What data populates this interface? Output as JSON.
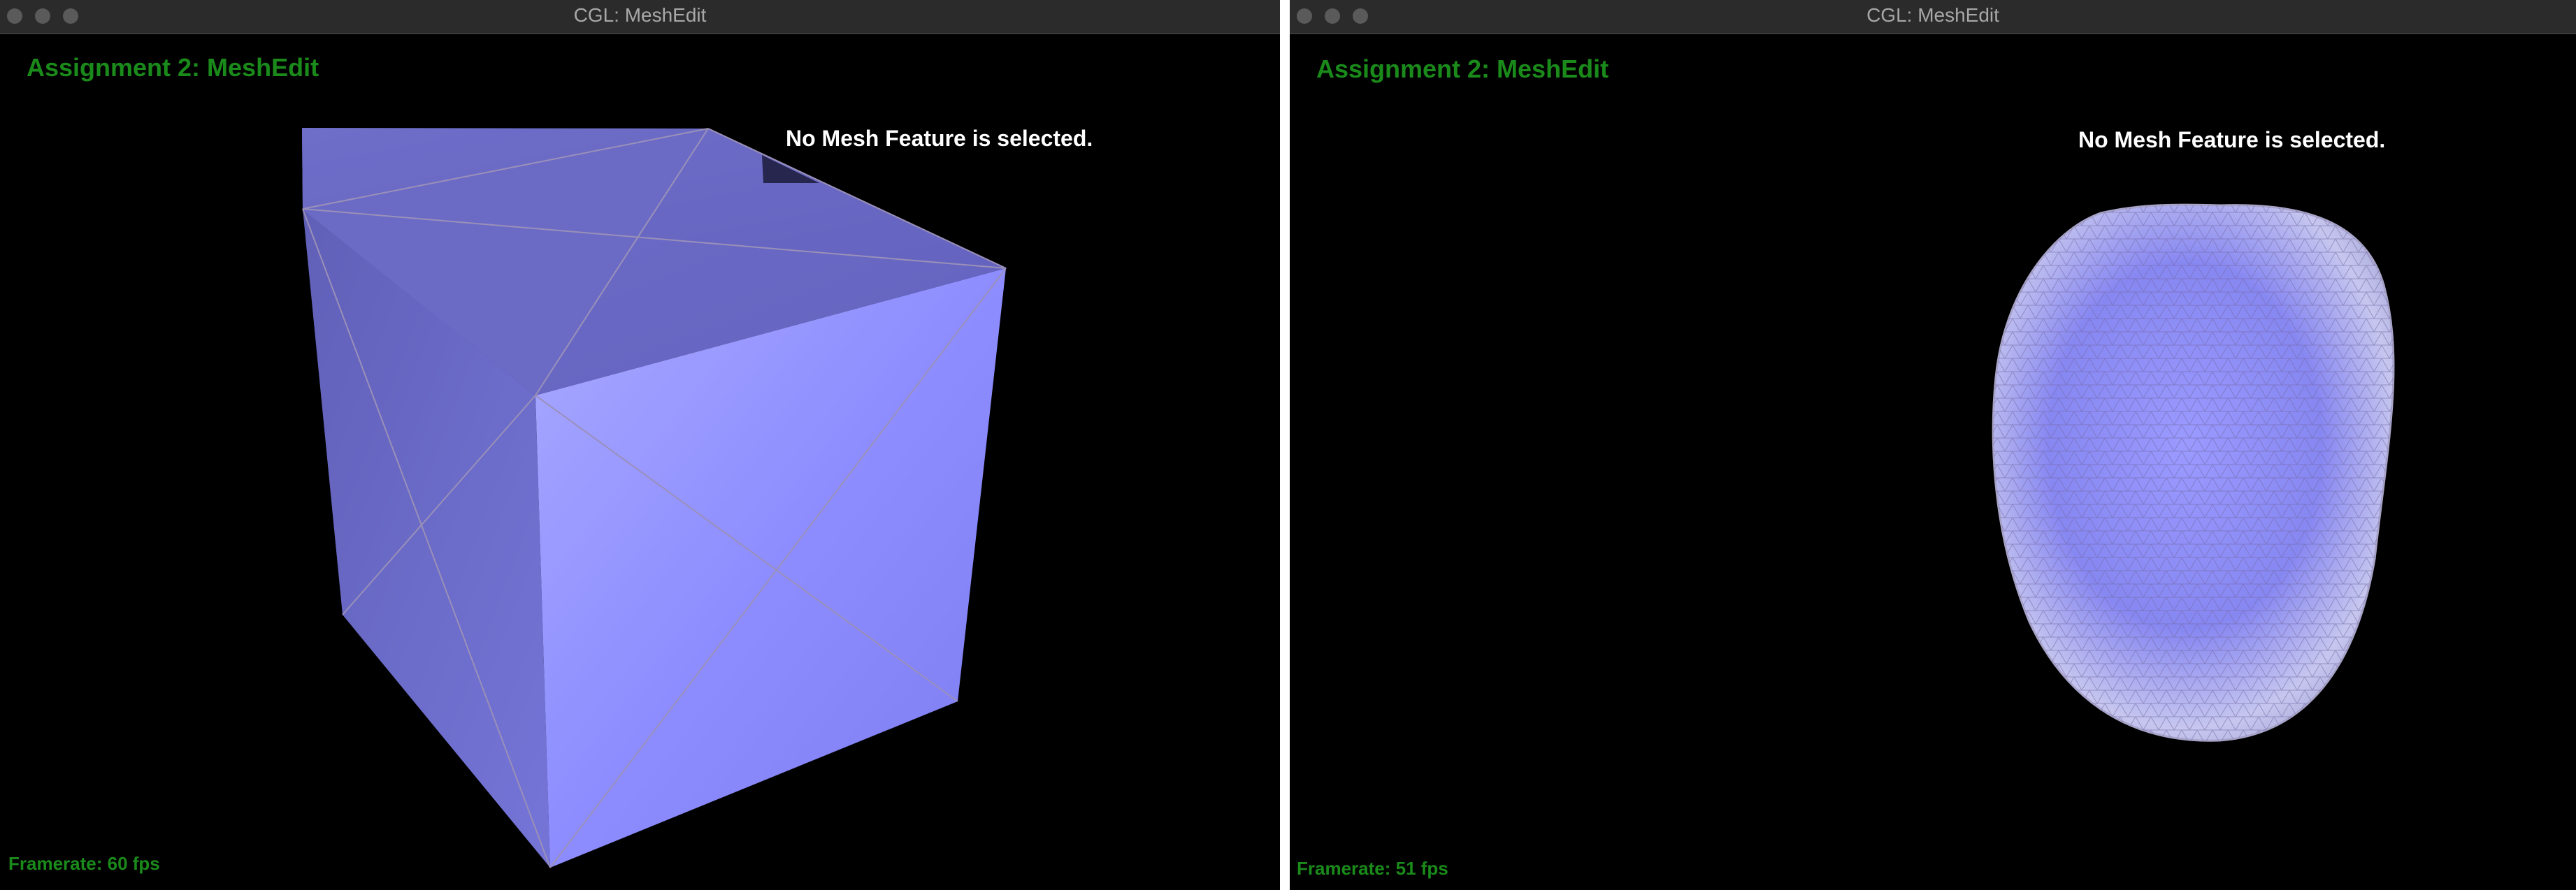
{
  "windows": [
    {
      "title": "CGL: MeshEdit",
      "app_title": "Assignment 2: MeshEdit",
      "selection_status": "No Mesh Feature is selected.",
      "framerate": "Framerate: 60 fps",
      "mesh": "cube"
    },
    {
      "title": "CGL: MeshEdit",
      "app_title": "Assignment 2: MeshEdit",
      "selection_status": "No Mesh Feature is selected.",
      "framerate": "Framerate: 51 fps",
      "mesh": "subdivided-blob"
    }
  ],
  "colors": {
    "mesh_face": "#8f8fff",
    "mesh_edge": "#9a90b8",
    "hud_green": "#1a8a1a",
    "background": "#000000"
  }
}
